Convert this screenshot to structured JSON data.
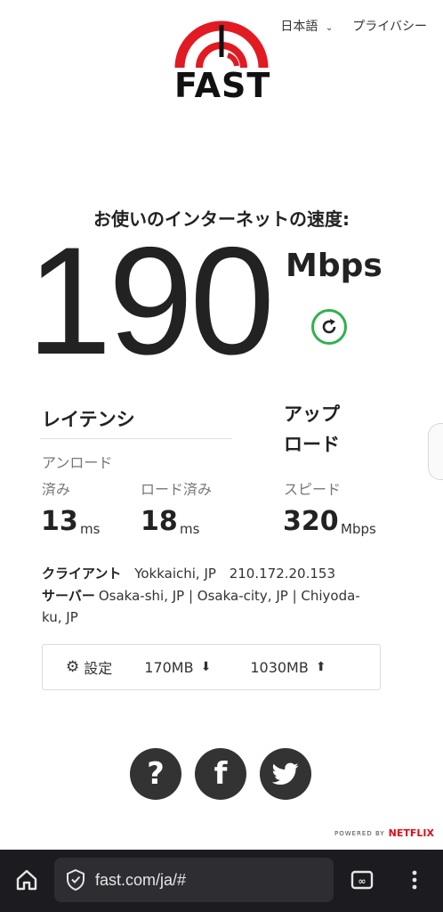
{
  "nav": {
    "language": "日本語",
    "privacy": "プライバシー"
  },
  "logo": {
    "text": "FAST"
  },
  "speed": {
    "label": "お使いのインターネットの速度:",
    "value": "190",
    "unit": "Mbps"
  },
  "latency": {
    "title": "レイテンシ",
    "unloaded_label_line1": "アンロード",
    "unloaded_label_line2": "済み",
    "loaded_label": "ロード済み",
    "unloaded_value": "13",
    "unloaded_unit": "ms",
    "loaded_value": "18",
    "loaded_unit": "ms"
  },
  "upload": {
    "title_line1": "アップ",
    "title_line2": "ロード",
    "label": "スピード",
    "value": "320",
    "unit": "Mbps"
  },
  "client": {
    "label": "クライアント",
    "location": "Yokkaichi, JP",
    "ip": "210.172.20.153"
  },
  "server": {
    "label": "サーバー",
    "line1": "Osaka-shi, JP  |  Osaka-city, JP  |  Chiyoda-",
    "line2": "ku, JP"
  },
  "settings": {
    "label": "設定",
    "download_size": "170MB",
    "upload_size": "1030MB"
  },
  "powered_by": {
    "prefix": "POWERED BY",
    "brand": "NETFLIX"
  },
  "browser": {
    "url": "fast.com/ja/#"
  },
  "colors": {
    "accent_red": "#e21a22",
    "refresh_green": "#2db34a",
    "social_gray": "#333333",
    "netflix_red": "#e50914"
  }
}
